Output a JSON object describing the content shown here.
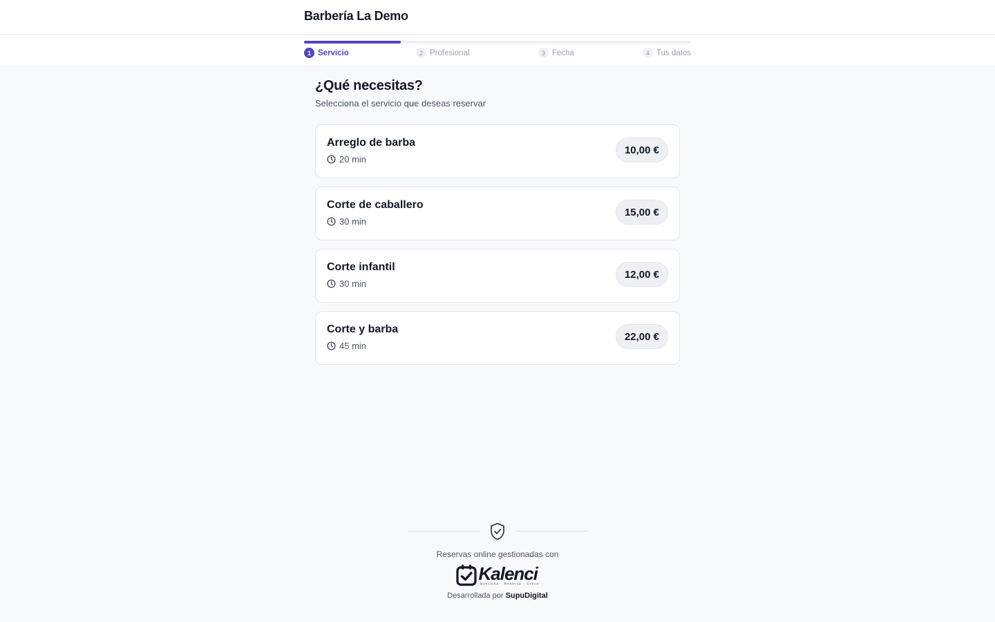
{
  "header": {
    "brand": "Barbería La Demo"
  },
  "stepper": {
    "progress": 0.25,
    "steps": [
      {
        "num": "1",
        "label": "Servicio",
        "active": true
      },
      {
        "num": "2",
        "label": "Profesional",
        "active": false
      },
      {
        "num": "3",
        "label": "Fecha",
        "active": false
      },
      {
        "num": "4",
        "label": "Tus datos",
        "active": false
      }
    ]
  },
  "main": {
    "title": "¿Qué necesitas?",
    "subtitle": "Selecciona el servicio que deseas reservar",
    "services": [
      {
        "name": "Arreglo de barba",
        "duration": "20 min",
        "price": "10,00 €"
      },
      {
        "name": "Corte de caballero",
        "duration": "30 min",
        "price": "15,00 €"
      },
      {
        "name": "Corte infantil",
        "duration": "30 min",
        "price": "12,00 €"
      },
      {
        "name": "Corte y barba",
        "duration": "45 min",
        "price": "22,00 €"
      }
    ]
  },
  "footer": {
    "managed_text": "Reservas online gestionadas con",
    "logo_name": "Kalenci",
    "logo_tagline": "Gestiona · Reserva · Crece",
    "credit_prefix": "Desarrollada por",
    "credit_name": "SupuDigital",
    "icons": {
      "shield": "shield-check-icon",
      "logo": "calendar-check-icon",
      "clock": "clock-icon"
    }
  },
  "colors": {
    "accent": "#4f46c8",
    "text": "#111827",
    "muted": "#4b5563",
    "background": "#f8f9fb"
  }
}
